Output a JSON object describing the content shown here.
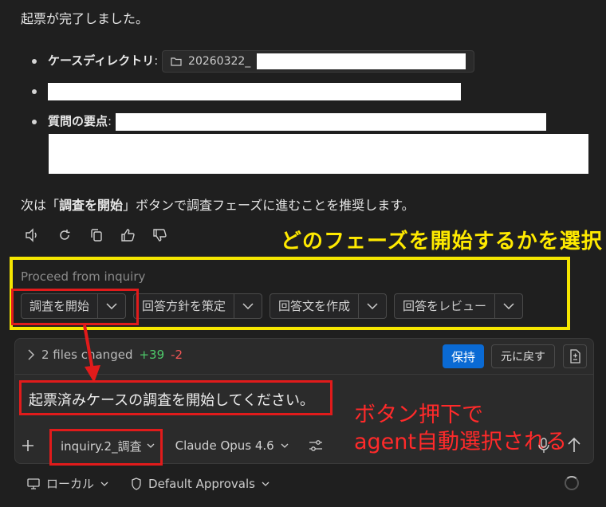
{
  "message": {
    "title": "起票が完了しました。",
    "bullets": [
      {
        "label": "ケースディレクトリ",
        "sep": ":",
        "value": "20260322_"
      },
      {
        "label": "",
        "sep": "",
        "value": ""
      },
      {
        "label": "質問の要点",
        "sep": ":",
        "value": ""
      }
    ],
    "recommend_prefix": "次は「",
    "recommend_bold": "調査を開始",
    "recommend_suffix": "」ボタンで調査フェーズに進むことを推奨します。"
  },
  "annotations": {
    "phase_select": "どのフェーズを開始するかを選択",
    "auto_select_line1": "ボタン押下で",
    "auto_select_line2": "agent自動選択される"
  },
  "proceed": {
    "label": "Proceed from inquiry",
    "steps": [
      "調査を開始",
      "回答方針を策定",
      "回答文を作成",
      "回答をレビュー"
    ]
  },
  "changes": {
    "files_changed": "2 files changed",
    "additions": "+39",
    "deletions": "-2",
    "keep_label": "保持",
    "undo_label": "元に戻す"
  },
  "composer": {
    "prompt": "起票済みケースの調査を開始してください。",
    "agent": "inquiry.2_調査",
    "model": "Claude Opus 4.6"
  },
  "status": {
    "location": "ローカル",
    "approvals": "Default Approvals"
  }
}
